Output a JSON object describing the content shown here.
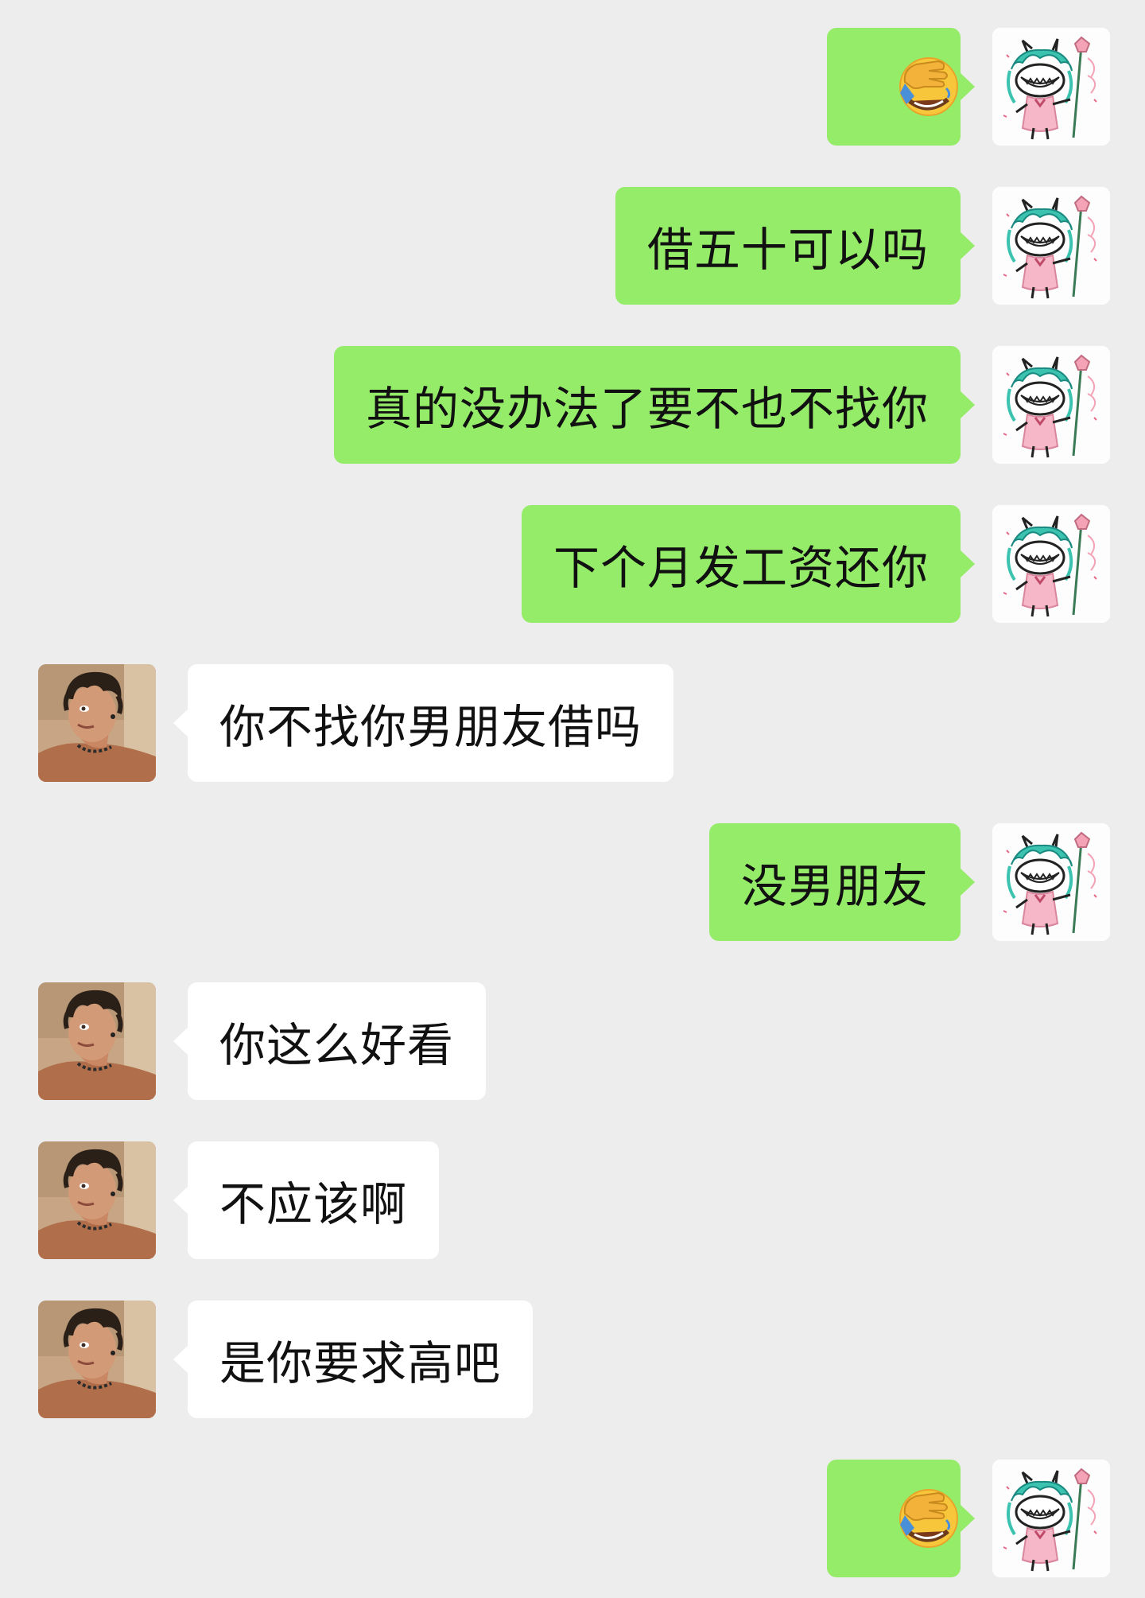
{
  "chat": {
    "emoji_name": "facepalm-emoji",
    "messages": [
      {
        "side": "me",
        "type": "emoji"
      },
      {
        "side": "me",
        "text": "借五十可以吗"
      },
      {
        "side": "me",
        "text": "真的没办法了要不也不找你"
      },
      {
        "side": "me",
        "text": "下个月发工资还你"
      },
      {
        "side": "them",
        "text": "你不找你男朋友借吗"
      },
      {
        "side": "me",
        "text": "没男朋友"
      },
      {
        "side": "them",
        "text": "你这么好看"
      },
      {
        "side": "them",
        "text": "不应该啊"
      },
      {
        "side": "them",
        "text": "是你要求高吧"
      },
      {
        "side": "me",
        "type": "emoji"
      }
    ]
  },
  "colors": {
    "background": "#ededed",
    "my_bubble": "#95ec69",
    "their_bubble": "#ffffff"
  }
}
